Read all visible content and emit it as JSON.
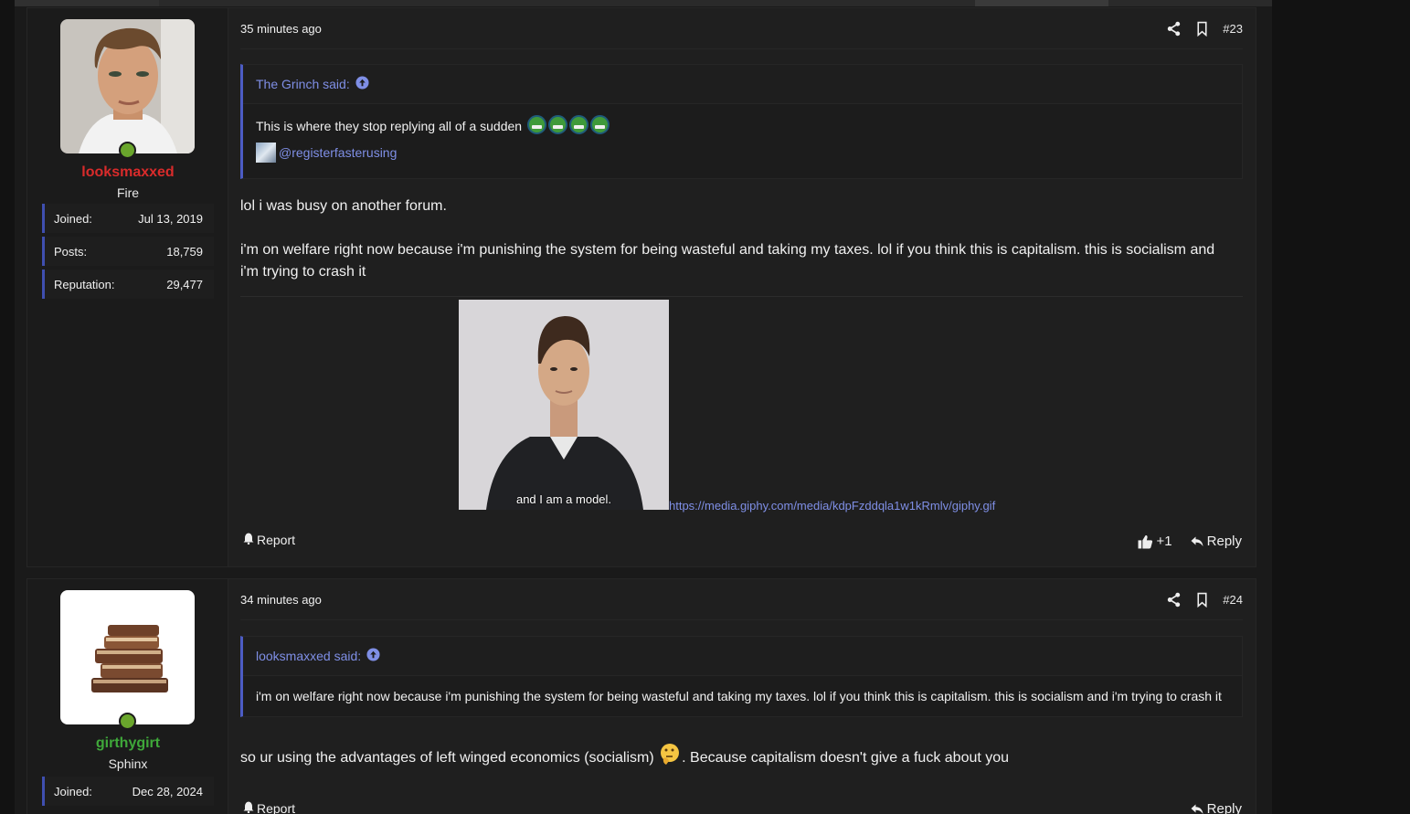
{
  "posts": [
    {
      "user": {
        "name": "looksmaxxed",
        "name_color": "#d92b2b",
        "title": "Fire",
        "stats": [
          {
            "label": "Joined:",
            "value": "Jul 13, 2019"
          },
          {
            "label": "Posts:",
            "value": "18,759"
          },
          {
            "label": "Reputation:",
            "value": "29,477"
          }
        ]
      },
      "time": "35 minutes ago",
      "post_number": "#23",
      "quote": {
        "author_line": "The Grinch said:",
        "text": "This is where they stop replying all of a sudden",
        "mention": "@registerfasterusing"
      },
      "paragraphs": [
        "lol i was busy on another forum.",
        "i'm on welfare right now because i'm punishing the system for being wasteful and taking my taxes. lol if you think this is capitalism. this is socialism and i'm trying to crash it"
      ],
      "gif_caption": "and I am a model.",
      "gif_link": "https://media.giphy.com/media/kdpFzddqla1w1kRmlv/giphy.gif",
      "report_label": "Report",
      "like_label": "+1",
      "reply_label": "Reply"
    },
    {
      "user": {
        "name": "girthygirt",
        "name_color": "#3fa83a",
        "title": "Sphinx",
        "stats": [
          {
            "label": "Joined:",
            "value": "Dec 28, 2024"
          }
        ]
      },
      "time": "34 minutes ago",
      "post_number": "#24",
      "quote": {
        "author_line": "looksmaxxed said:",
        "text": "i'm on welfare right now because i'm punishing the system for being wasteful and taking my taxes. lol if you think this is capitalism. this is socialism and i'm trying to crash it"
      },
      "body_before_emoji": "so ur using the advantages of left winged economics (socialism) ",
      "body_after_emoji": ". Because capitalism doesn't give a fuck about you",
      "report_label": "Report",
      "reply_label": "Reply"
    }
  ],
  "colors": {
    "accent": "#4c5cc4",
    "link": "#7f8fe6",
    "online": "#6aa62c"
  },
  "icons": [
    "share-icon",
    "bookmark-icon",
    "arrow-up-circle-icon",
    "bell-icon",
    "thumbs-up-icon",
    "reply-arrow-icon"
  ]
}
